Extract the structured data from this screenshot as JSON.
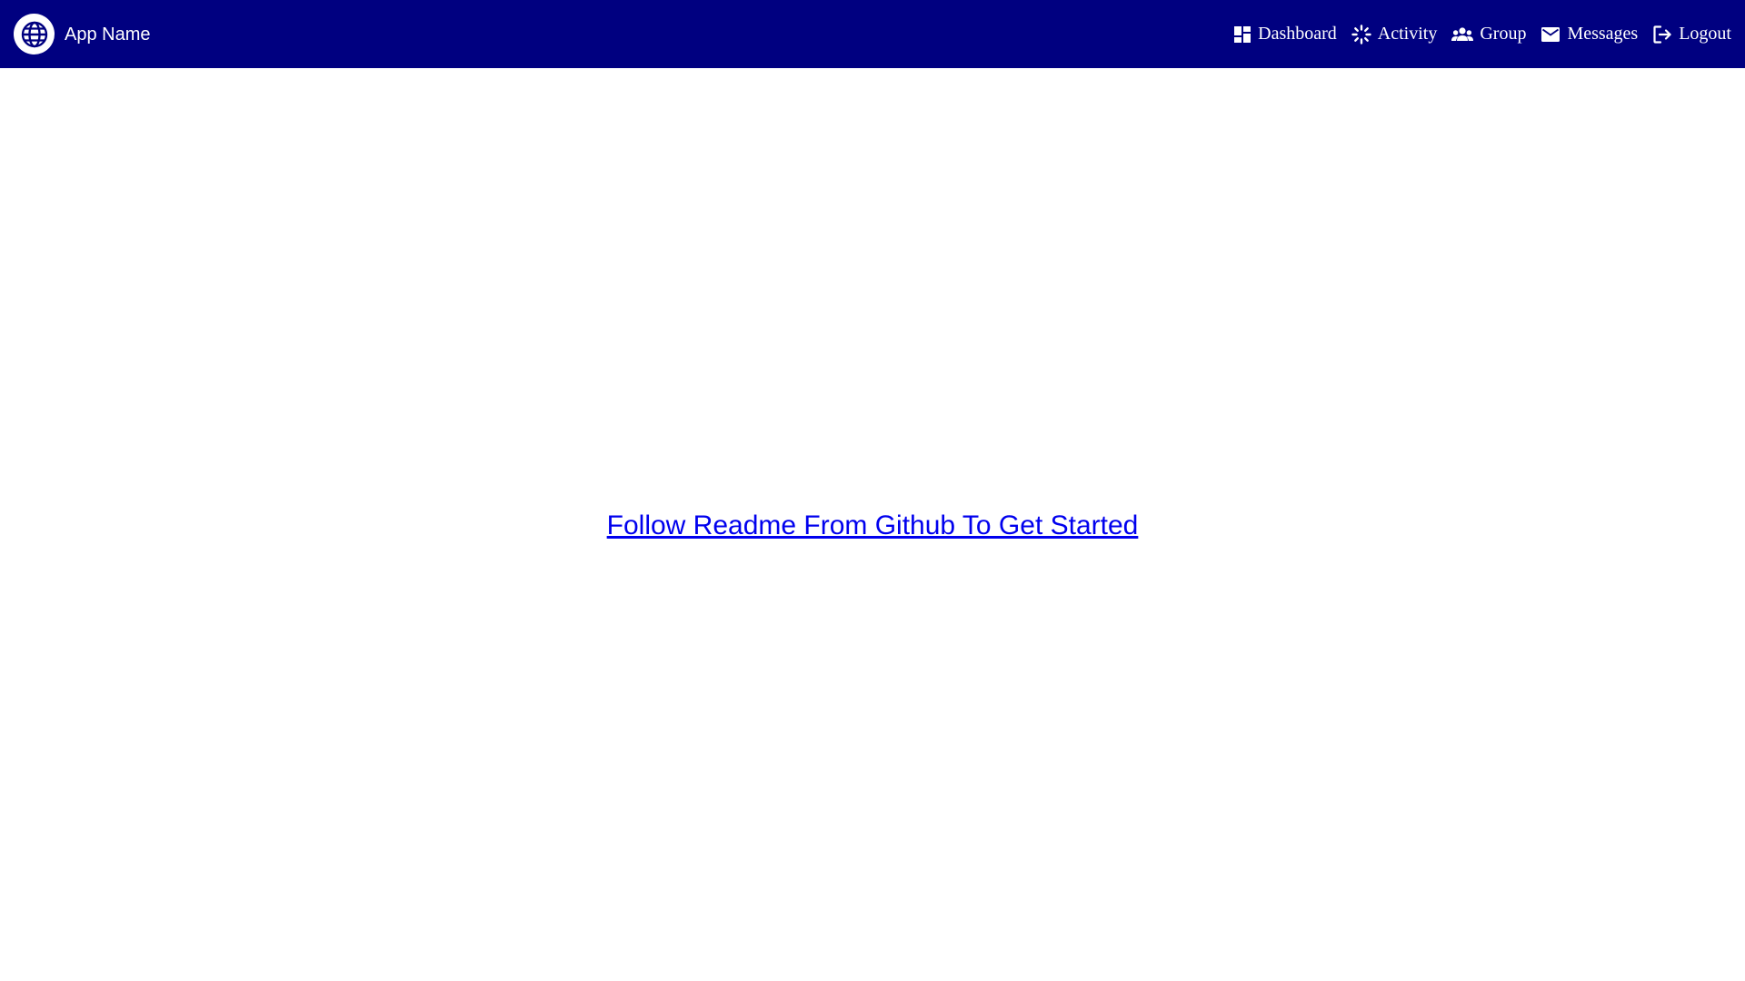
{
  "header": {
    "brand": {
      "logo_icon": "globe-icon",
      "name": "App Name"
    },
    "nav": [
      {
        "label": "Dashboard",
        "icon": "dashboard-icon"
      },
      {
        "label": "Activity",
        "icon": "activity-icon"
      },
      {
        "label": "Group",
        "icon": "group-icon"
      },
      {
        "label": "Messages",
        "icon": "mail-icon"
      },
      {
        "label": "Logout",
        "icon": "logout-icon"
      }
    ]
  },
  "main": {
    "link_text": "Follow Readme From Github To Get Started"
  },
  "colors": {
    "navbar_background": "#000080",
    "nav_text": "#ffffff",
    "link": "#0000ee",
    "page_background": "#ffffff"
  }
}
